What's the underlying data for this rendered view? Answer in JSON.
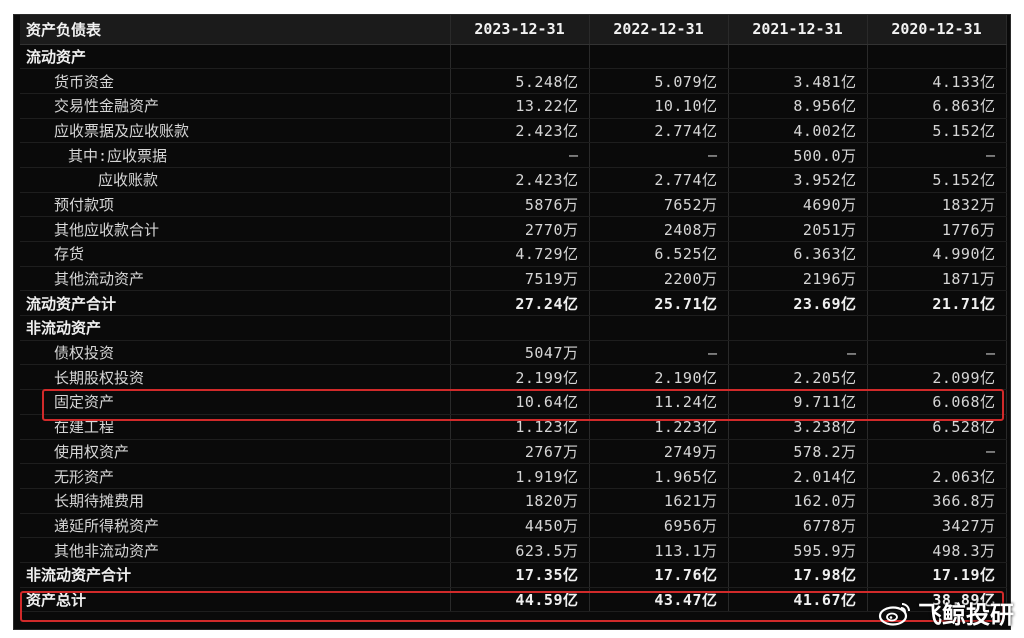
{
  "header": {
    "title": "资产负债表",
    "periods": [
      "2023-12-31",
      "2022-12-31",
      "2021-12-31",
      "2020-12-31"
    ]
  },
  "rows": [
    {
      "label": "流动资产",
      "level": "section",
      "values": [
        "",
        "",
        "",
        ""
      ]
    },
    {
      "label": "货币资金",
      "level": "lvl1",
      "values": [
        "5.248亿",
        "5.079亿",
        "3.481亿",
        "4.133亿"
      ]
    },
    {
      "label": "交易性金融资产",
      "level": "lvl1",
      "values": [
        "13.22亿",
        "10.10亿",
        "8.956亿",
        "6.863亿"
      ]
    },
    {
      "label": "应收票据及应收账款",
      "level": "lvl1",
      "values": [
        "2.423亿",
        "2.774亿",
        "4.002亿",
        "5.152亿"
      ]
    },
    {
      "label": "其中:应收票据",
      "level": "lvl2",
      "values": [
        "—",
        "—",
        "500.0万",
        "—"
      ]
    },
    {
      "label": "应收账款",
      "level": "lvl3",
      "values": [
        "2.423亿",
        "2.774亿",
        "3.952亿",
        "5.152亿"
      ]
    },
    {
      "label": "预付款项",
      "level": "lvl1",
      "values": [
        "5876万",
        "7652万",
        "4690万",
        "1832万"
      ]
    },
    {
      "label": "其他应收款合计",
      "level": "lvl1",
      "values": [
        "2770万",
        "2408万",
        "2051万",
        "1776万"
      ]
    },
    {
      "label": "存货",
      "level": "lvl1",
      "values": [
        "4.729亿",
        "6.525亿",
        "6.363亿",
        "4.990亿"
      ]
    },
    {
      "label": "其他流动资产",
      "level": "lvl1",
      "values": [
        "7519万",
        "2200万",
        "2196万",
        "1871万"
      ]
    },
    {
      "label": "流动资产合计",
      "level": "total",
      "values": [
        "27.24亿",
        "25.71亿",
        "23.69亿",
        "21.71亿"
      ]
    },
    {
      "label": "非流动资产",
      "level": "section",
      "values": [
        "",
        "",
        "",
        ""
      ]
    },
    {
      "label": "债权投资",
      "level": "lvl1",
      "values": [
        "5047万",
        "—",
        "—",
        "—"
      ]
    },
    {
      "label": "长期股权投资",
      "level": "lvl1",
      "values": [
        "2.199亿",
        "2.190亿",
        "2.205亿",
        "2.099亿"
      ]
    },
    {
      "label": "固定资产",
      "level": "lvl1",
      "values": [
        "10.64亿",
        "11.24亿",
        "9.711亿",
        "6.068亿"
      ]
    },
    {
      "label": "在建工程",
      "level": "lvl1",
      "values": [
        "1.123亿",
        "1.223亿",
        "3.238亿",
        "6.528亿"
      ]
    },
    {
      "label": "使用权资产",
      "level": "lvl1",
      "values": [
        "2767万",
        "2749万",
        "578.2万",
        "—"
      ]
    },
    {
      "label": "无形资产",
      "level": "lvl1",
      "values": [
        "1.919亿",
        "1.965亿",
        "2.014亿",
        "2.063亿"
      ]
    },
    {
      "label": "长期待摊费用",
      "level": "lvl1",
      "values": [
        "1820万",
        "1621万",
        "162.0万",
        "366.8万"
      ]
    },
    {
      "label": "递延所得税资产",
      "level": "lvl1",
      "values": [
        "4450万",
        "6956万",
        "6778万",
        "3427万"
      ]
    },
    {
      "label": "其他非流动资产",
      "level": "lvl1",
      "values": [
        "623.5万",
        "113.1万",
        "595.9万",
        "498.3万"
      ]
    },
    {
      "label": "非流动资产合计",
      "level": "total",
      "values": [
        "17.35亿",
        "17.76亿",
        "17.98亿",
        "17.19亿"
      ]
    },
    {
      "label": "资产总计",
      "level": "total",
      "values": [
        "44.59亿",
        "43.47亿",
        "41.67亿",
        "38.89亿"
      ]
    }
  ],
  "watermark": {
    "text": "飞鲸投研",
    "icon": "weibo-logo-icon"
  },
  "colors": {
    "highlight": "#d12a2a",
    "background": "#0a0a0a",
    "text": "#d6d6d6"
  }
}
